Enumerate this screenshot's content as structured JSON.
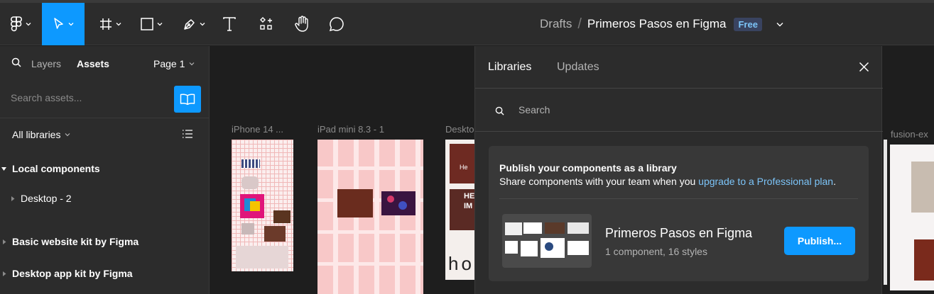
{
  "toolbar": {
    "tools": [
      {
        "name": "main-menu",
        "icon": "figma-logo-icon"
      },
      {
        "name": "move-tool",
        "icon": "cursor-arrow-icon",
        "active": true
      },
      {
        "name": "frame-tool",
        "icon": "hash-frame-icon"
      },
      {
        "name": "shape-tool",
        "icon": "square-icon"
      },
      {
        "name": "pen-tool",
        "icon": "pen-nib-icon"
      },
      {
        "name": "text-tool",
        "icon": "text-t-icon"
      },
      {
        "name": "resources-tool",
        "icon": "resources-icon"
      },
      {
        "name": "hand-tool",
        "icon": "hand-icon"
      },
      {
        "name": "comment-tool",
        "icon": "comment-bubble-icon"
      }
    ],
    "breadcrumb": {
      "folder": "Drafts",
      "separator": "/",
      "file": "Primeros Pasos en Figma",
      "badge": "Free"
    },
    "accent": "#0d99ff"
  },
  "sidebar": {
    "tabs": {
      "layers": "Layers",
      "assets": "Assets"
    },
    "page": "Page 1",
    "search_placeholder": "Search assets...",
    "filter": "All libraries",
    "sections": [
      {
        "label": "Local components",
        "expanded": true,
        "children": [
          "Desktop - 2"
        ]
      },
      {
        "label": "Basic website kit by Figma",
        "expanded": false
      },
      {
        "label": "Desktop app kit by Figma",
        "expanded": false
      }
    ]
  },
  "canvas": {
    "frames": [
      {
        "label": "iPhone 14 ..."
      },
      {
        "label": "iPad mini 8.3 - 1"
      },
      {
        "label": "Deskto"
      },
      {
        "label": "fusion-ex"
      }
    ],
    "snippets": {
      "desktop_text_1": "He",
      "desktop_text_2": "HE",
      "desktop_text_3": "IM",
      "desktop_text_4": "ho"
    }
  },
  "libraries_panel": {
    "tabs": {
      "libraries": "Libraries",
      "updates": "Updates"
    },
    "search_placeholder": "Search",
    "publish_card": {
      "heading": "Publish your components as a library",
      "text_before_link": "Share components with your team when you ",
      "link": "upgrade to a Professional plan",
      "text_after_link": ".",
      "library_name": "Primeros Pasos en Figma",
      "library_meta": "1 component, 16 styles",
      "button": "Publish..."
    }
  }
}
